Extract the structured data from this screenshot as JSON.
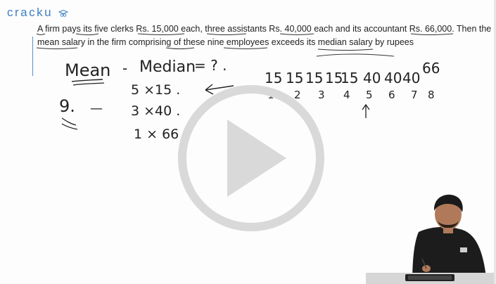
{
  "logo": {
    "text": "cracku"
  },
  "question": {
    "line1": "A firm pays its five clerks Rs. 15,000 each, three assistants Rs. 40,000 each and its accountant Rs. 66,000. Then the",
    "line2": "mean salary in the firm comprising of these nine employees exceeds its median salary by rupees"
  },
  "board": {
    "mean_label": "Mean",
    "dash": "-",
    "median_label": "Median",
    "equals_q": "= ? .",
    "row1": "5 ×15 .",
    "row2": "3 ×40 .",
    "row3": "1 × 66",
    "nine": "9.",
    "nine_dash": "—",
    "sorted_values": [
      "15",
      "15",
      "15",
      "15",
      "15",
      "40",
      "40",
      "40",
      "66"
    ],
    "positions": [
      "1",
      "2",
      "3",
      "4",
      "5",
      "6",
      "7",
      "8"
    ]
  },
  "video": {
    "state": "paused",
    "icon": "play-icon"
  },
  "colors": {
    "brand": "#3d7fc4",
    "ink": "#222222",
    "overlay": "#d9d9d9"
  }
}
